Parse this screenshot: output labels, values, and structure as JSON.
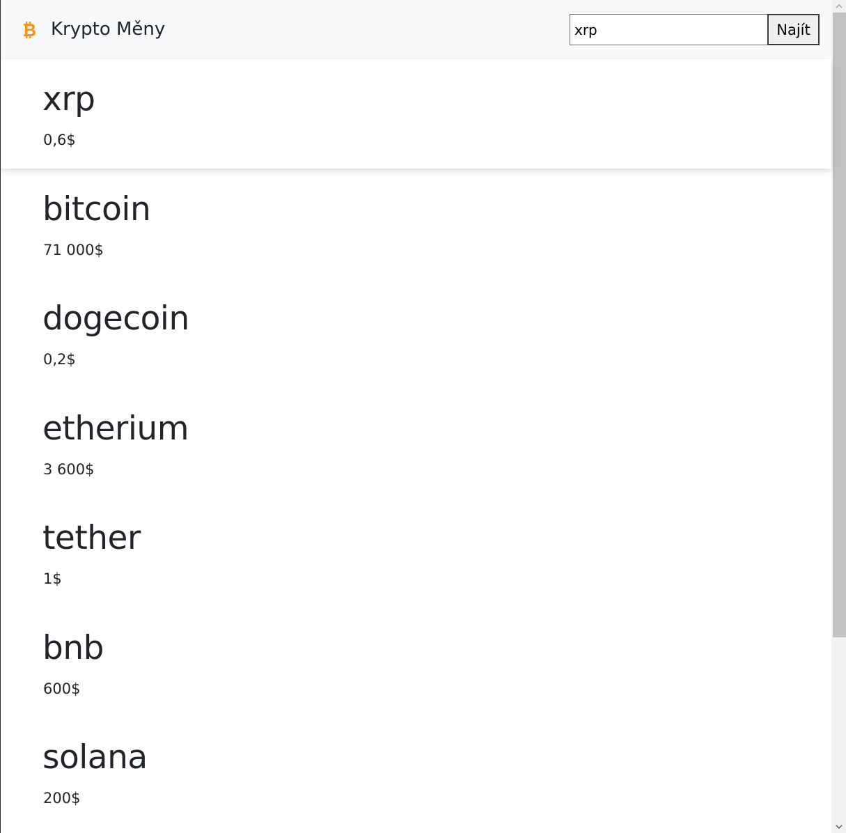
{
  "navbar": {
    "brand_icon": "bitcoin-icon",
    "brand_icon_color": "#f7931a",
    "title": "Krypto Měny"
  },
  "search": {
    "value": "xrp",
    "button_label": "Najít"
  },
  "cards": [
    {
      "name": "xrp",
      "price": "0,6$"
    },
    {
      "name": "bitcoin",
      "price": "71 000$"
    },
    {
      "name": "dogecoin",
      "price": "0,2$"
    },
    {
      "name": "etherium",
      "price": "3 600$"
    },
    {
      "name": "tether",
      "price": "1$"
    },
    {
      "name": "bnb",
      "price": "600$"
    },
    {
      "name": "solana",
      "price": "200$"
    }
  ],
  "scrollbar": {
    "position_fraction": 0,
    "visible_fraction": 0.77
  }
}
